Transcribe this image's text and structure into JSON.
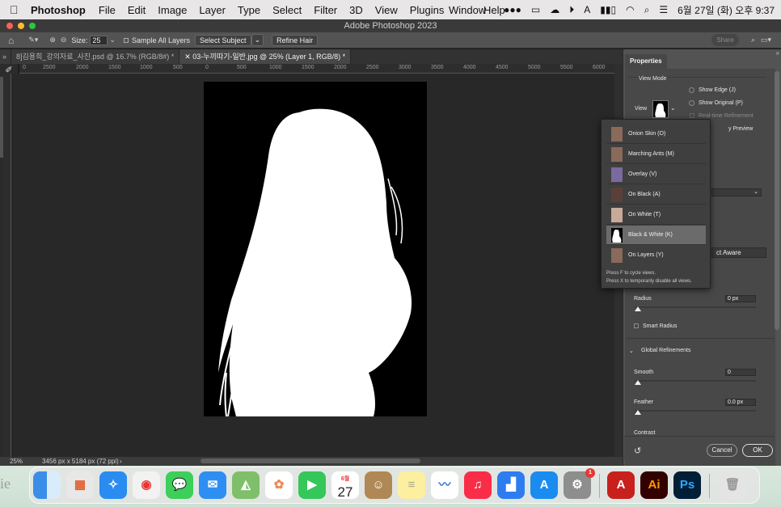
{
  "menubar": {
    "app": "Photoshop",
    "items": [
      "File",
      "Edit",
      "Image",
      "Layer",
      "Type",
      "Select",
      "Filter",
      "3D",
      "View",
      "Plugins"
    ],
    "right_items": [
      "Window",
      "Help"
    ],
    "clock": "6월 27일 (화) 오후 9:37"
  },
  "window": {
    "title": "Adobe Photoshop 2023"
  },
  "options": {
    "size_label": "Size:",
    "size_value": "25",
    "sample_all_layers": "Sample All Layers",
    "select_subject": "Select Subject",
    "refine_hair": "Refine Hair",
    "share": "Share"
  },
  "tabs": [
    {
      "label": "8]김용희_강의자료_사진.psd @ 16.7% (RGB/8#) *"
    },
    {
      "label": "03-누끼따기-일반.jpg @ 25% (Layer 1, RGB/8) *"
    }
  ],
  "ruler": {
    "h_ticks": [
      "0",
      "2500",
      "2000",
      "1500",
      "1000",
      "500",
      "0",
      "500",
      "1000",
      "1500",
      "2000",
      "2500",
      "3000",
      "3500",
      "4000",
      "4500",
      "5000",
      "5500",
      "6000"
    ]
  },
  "status": {
    "zoom": "25%",
    "doc_info": "3456 px x 5184 px (72 ppi)",
    "arrow": "›"
  },
  "properties": {
    "tab": "Properties",
    "view_mode": "View Mode",
    "view_label": "View",
    "show_edge": "Show Edge (J)",
    "show_original": "Show Original (P)",
    "realtime": "Real-time Refinement",
    "preview": "y Preview",
    "object_aware": "ct Aware",
    "radius_label": "Radius",
    "radius_value": "0 px",
    "smart_radius": "Smart Radius",
    "global_refinements": "Global Refinements",
    "smooth_label": "Smooth",
    "smooth_value": "0",
    "feather_label": "Feather",
    "feather_value": "0.0 px",
    "contrast_label": "Contrast",
    "cancel": "Cancel",
    "ok": "OK"
  },
  "view_menu": {
    "items": [
      {
        "label": "Onion Skin (O)",
        "selected": false
      },
      {
        "label": "Marching Ants (M)",
        "selected": false
      },
      {
        "label": "Overlay (V)",
        "selected": false
      },
      {
        "label": "On Black (A)",
        "selected": false
      },
      {
        "label": "On White (T)",
        "selected": false
      },
      {
        "label": "Black & White (K)",
        "selected": true
      },
      {
        "label": "On Layers (Y)",
        "selected": false
      }
    ],
    "note1": "Press F to cycle views.",
    "note2": "Press X to temporarily disable all views."
  },
  "dock": {
    "calendar_month": "6월",
    "calendar_day": "27",
    "settings_badge": "1",
    "acrobat": "A",
    "illustrator": "Ai",
    "photoshop": "Ps",
    "edge_text": "ie"
  }
}
